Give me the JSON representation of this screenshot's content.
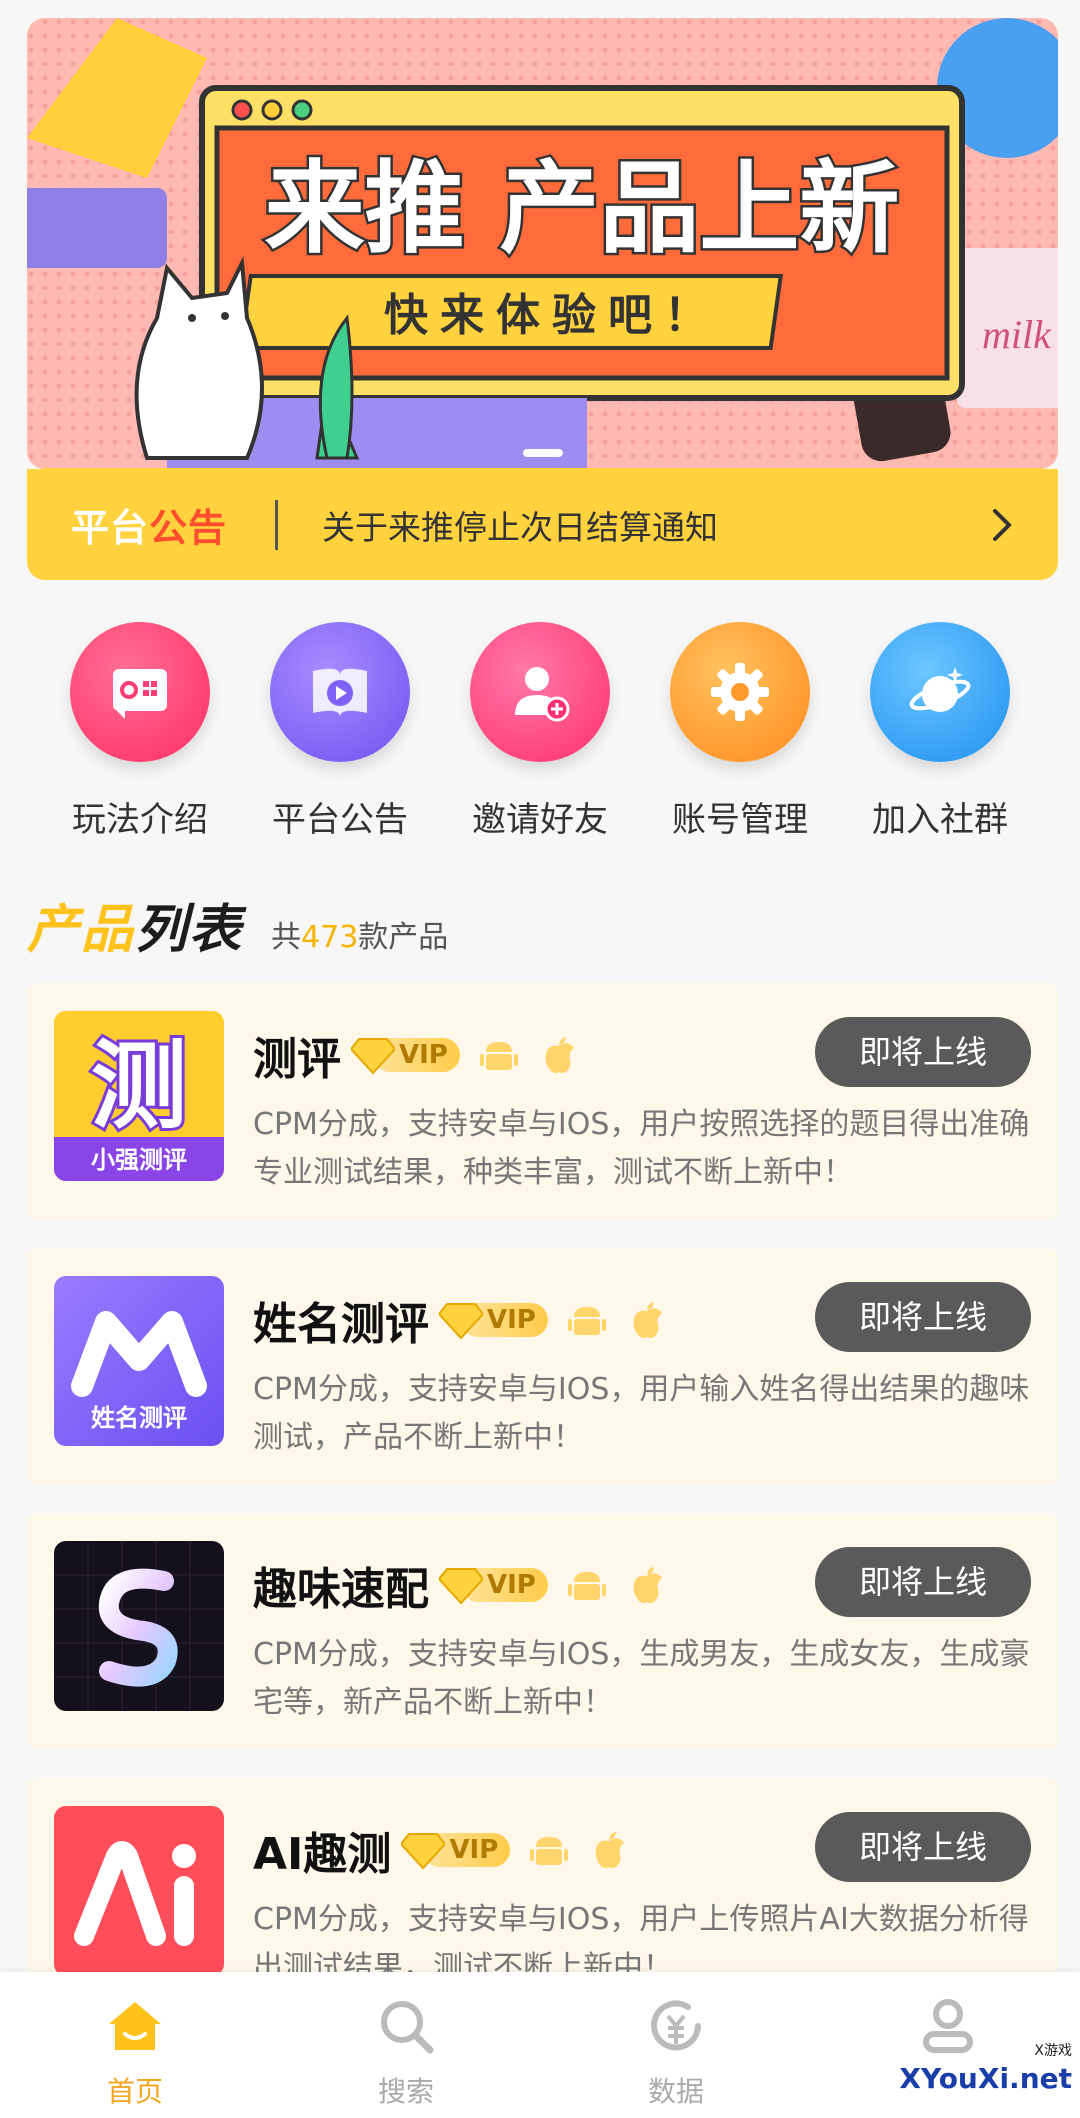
{
  "banner": {
    "headline": "来推 产品上新",
    "subline": "快来体验吧！",
    "milk_label": "milk"
  },
  "notice": {
    "tag_part1": "平台",
    "tag_part2": "公告",
    "text": "关于来推停止次日结算通知"
  },
  "menu": [
    {
      "label": "玩法介绍",
      "icon": "guide-icon",
      "color": "#ff3f73"
    },
    {
      "label": "平台公告",
      "icon": "video-book-icon",
      "color": "#8a6cff"
    },
    {
      "label": "邀请好友",
      "icon": "invite-user-icon",
      "color": "#ff4b85"
    },
    {
      "label": "账号管理",
      "icon": "gear-icon",
      "color": "#ff9f2e"
    },
    {
      "label": "加入社群",
      "icon": "planet-icon",
      "color": "#32a8ff"
    }
  ],
  "list": {
    "title_part1": "产品",
    "title_part2": "列表",
    "count_prefix": "共",
    "count": "473",
    "count_suffix": "款产品"
  },
  "products": [
    {
      "name": "测评",
      "vip": "VIP",
      "desc": "CPM分成，支持安卓与IOS，用户按照选择的题目得出准确专业测试结果，种类丰富，测试不断上新中！",
      "button": "即将上线",
      "logo_char": "测",
      "logo_sub": "小强测评"
    },
    {
      "name": "姓名测评",
      "vip": "VIP",
      "desc": "CPM分成，支持安卓与IOS，用户输入姓名得出结果的趣味测试，产品不断上新中！",
      "button": "即将上线",
      "logo_char": "M",
      "logo_sub": "姓名测评"
    },
    {
      "name": "趣味速配",
      "vip": "VIP",
      "desc": "CPM分成，支持安卓与IOS，生成男友，生成女友，生成豪宅等，新产品不断上新中！",
      "button": "即将上线",
      "logo_char": "S"
    },
    {
      "name": "AI趣测",
      "vip": "VIP",
      "desc": "CPM分成，支持安卓与IOS，用户上传照片AI大数据分析得出测试结果，测试不断上新中！",
      "button": "即将上线",
      "logo_char": "Ai"
    }
  ],
  "tabs": [
    {
      "label": "首页",
      "icon": "home-icon",
      "active": true
    },
    {
      "label": "搜索",
      "icon": "search-icon"
    },
    {
      "label": "数据",
      "icon": "yuan-data-icon"
    },
    {
      "label": "",
      "icon": "user-icon"
    }
  ],
  "watermark": {
    "sub": "X游戏",
    "main": "XYouXi.net"
  }
}
